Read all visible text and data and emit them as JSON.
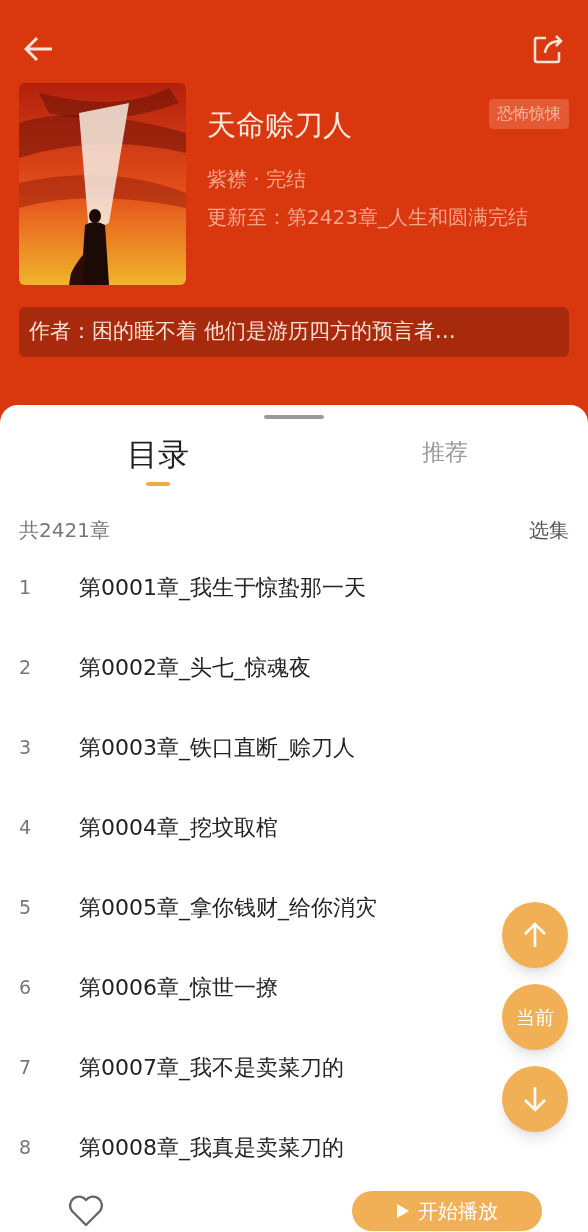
{
  "book": {
    "title": "天命赊刀人",
    "genre": "恐怖惊悚",
    "meta": "紫襟 · 完结",
    "update": "更新至：第2423章_人生和圆满完结",
    "intro": "作者：困的睡不着 他们是游历四方的预言者…"
  },
  "tabs": [
    {
      "label": "目录",
      "selected": true
    },
    {
      "label": "推荐",
      "selected": false
    }
  ],
  "summary": {
    "count": "共2421章",
    "select": "选集"
  },
  "chapters": [
    {
      "index": "1",
      "title": "第0001章_我生于惊蛰那一天"
    },
    {
      "index": "2",
      "title": "第0002章_头七_惊魂夜"
    },
    {
      "index": "3",
      "title": "第0003章_铁口直断_赊刀人"
    },
    {
      "index": "4",
      "title": "第0004章_挖坟取棺"
    },
    {
      "index": "5",
      "title": "第0005章_拿你钱财_给你消灾"
    },
    {
      "index": "6",
      "title": "第0006章_惊世一撩"
    },
    {
      "index": "7",
      "title": "第0007章_我不是卖菜刀的"
    },
    {
      "index": "8",
      "title": "第0008章_我真是卖菜刀的"
    }
  ],
  "float_buttons": [
    {
      "kind": "up"
    },
    {
      "kind": "current",
      "label": "当前"
    },
    {
      "kind": "down"
    }
  ],
  "play_button": {
    "label": "开始播放"
  }
}
